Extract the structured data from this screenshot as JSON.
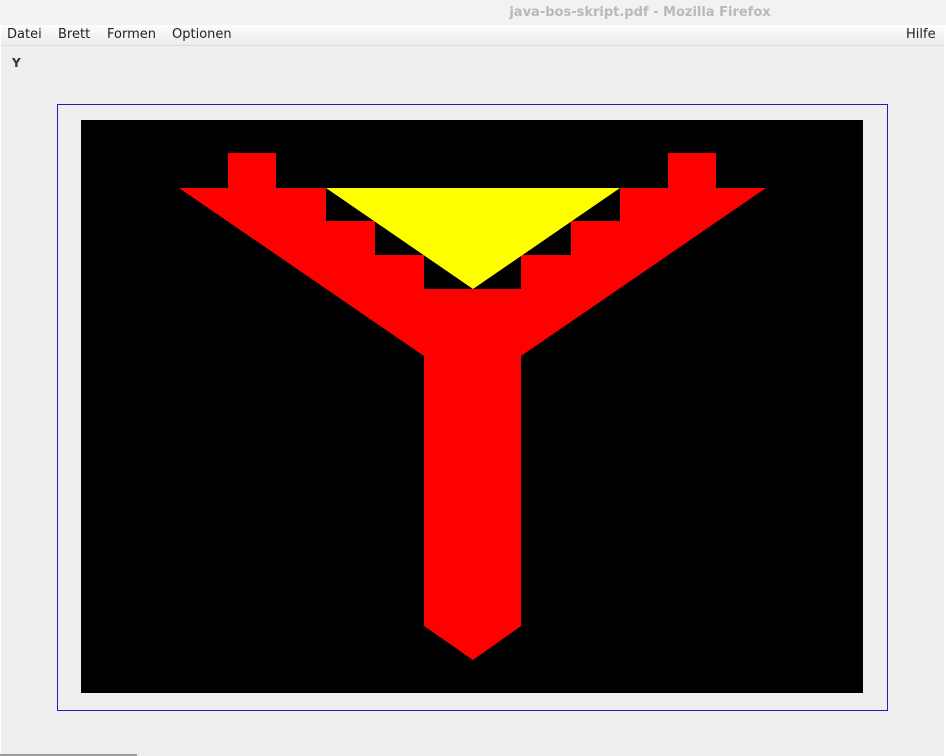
{
  "window": {
    "title": "java-bos-skript.pdf - Mozilla Firefox"
  },
  "menubar": {
    "items": [
      "Datei",
      "Brett",
      "Formen",
      "Optionen"
    ],
    "help": "Hilfe"
  },
  "board": {
    "label": "Y",
    "colors": {
      "background": "#000000",
      "red": "#ff0000",
      "yellow": "#ffff00",
      "frame_border": "#1f1fb4"
    }
  }
}
